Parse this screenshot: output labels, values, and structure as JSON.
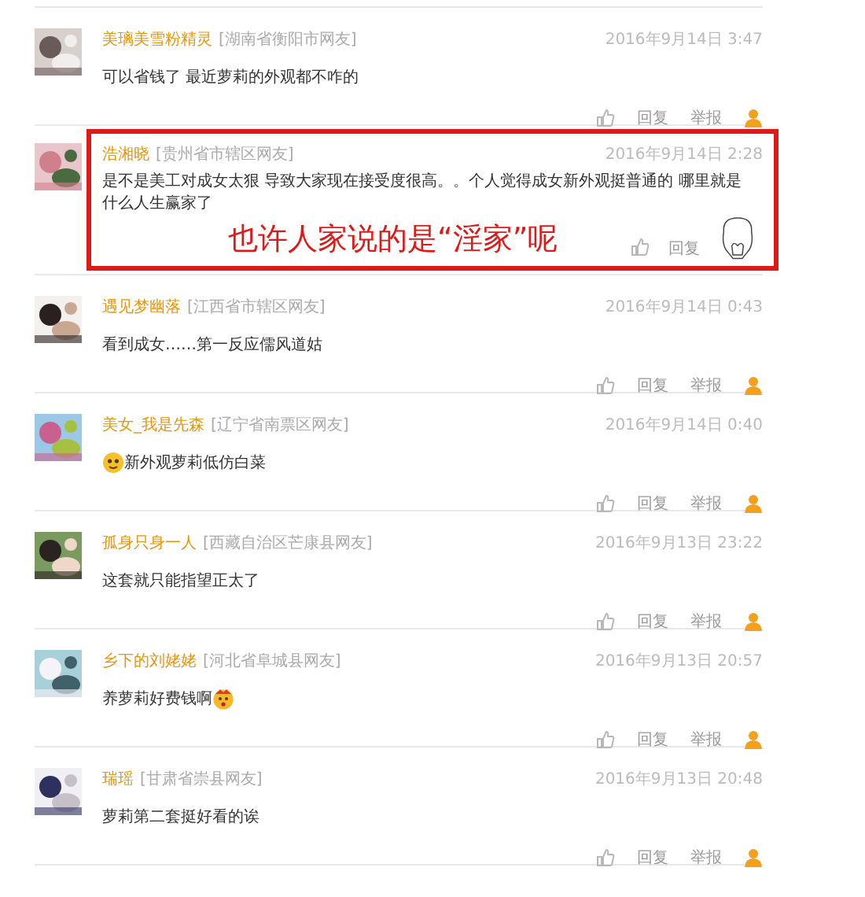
{
  "comments": [
    {
      "user": "美璃美雪粉精灵",
      "location": "[湖南省衡阳市网友]",
      "time": "2016年9月14日 3:47",
      "text": "可以省钱了 最近萝莉的外观都不咋的",
      "reply": "回复",
      "report": "举报",
      "highlighted": false
    },
    {
      "user": "浩湘晓",
      "location": "[贵州省市辖区网友]",
      "time": "2016年9月14日 2:28",
      "text": "是不是美工对成女太狠 导致大家现在接受度很高。。个人觉得成女新外观挺普通的 哪里就是什么人生赢家了",
      "reply": "回复",
      "highlighted": true,
      "annotation": "也许人家说的是“淫家”呢"
    },
    {
      "user": "遇见梦幽落",
      "location": "[江西省市辖区网友]",
      "time": "2016年9月14日 0:43",
      "text": "看到成女……第一反应儒风道姑",
      "reply": "回复",
      "report": "举报",
      "highlighted": false
    },
    {
      "user": "美女_我是先森",
      "location": "[辽宁省南票区网友]",
      "time": "2016年9月14日 0:40",
      "text": "新外观萝莉低仿白菜",
      "emoji_before": true,
      "reply": "回复",
      "report": "举报",
      "highlighted": false
    },
    {
      "user": "孤身只身一人",
      "location": "[西藏自治区芒康县网友]",
      "time": "2016年9月13日 23:22",
      "text": "这套就只能指望正太了",
      "reply": "回复",
      "report": "举报",
      "highlighted": false
    },
    {
      "user": "乡下的刘姥姥",
      "location": "[河北省阜城县网友]",
      "time": "2016年9月13日 20:57",
      "text": "养萝莉好费钱啊",
      "emoji_after": true,
      "reply": "回复",
      "report": "举报",
      "highlighted": false
    },
    {
      "user": "瑞瑶",
      "location": "[甘肃省崇县网友]",
      "time": "2016年9月13日 20:48",
      "text": "萝莉第二套挺好看的诶",
      "reply": "回复",
      "report": "举报",
      "highlighted": false
    }
  ]
}
